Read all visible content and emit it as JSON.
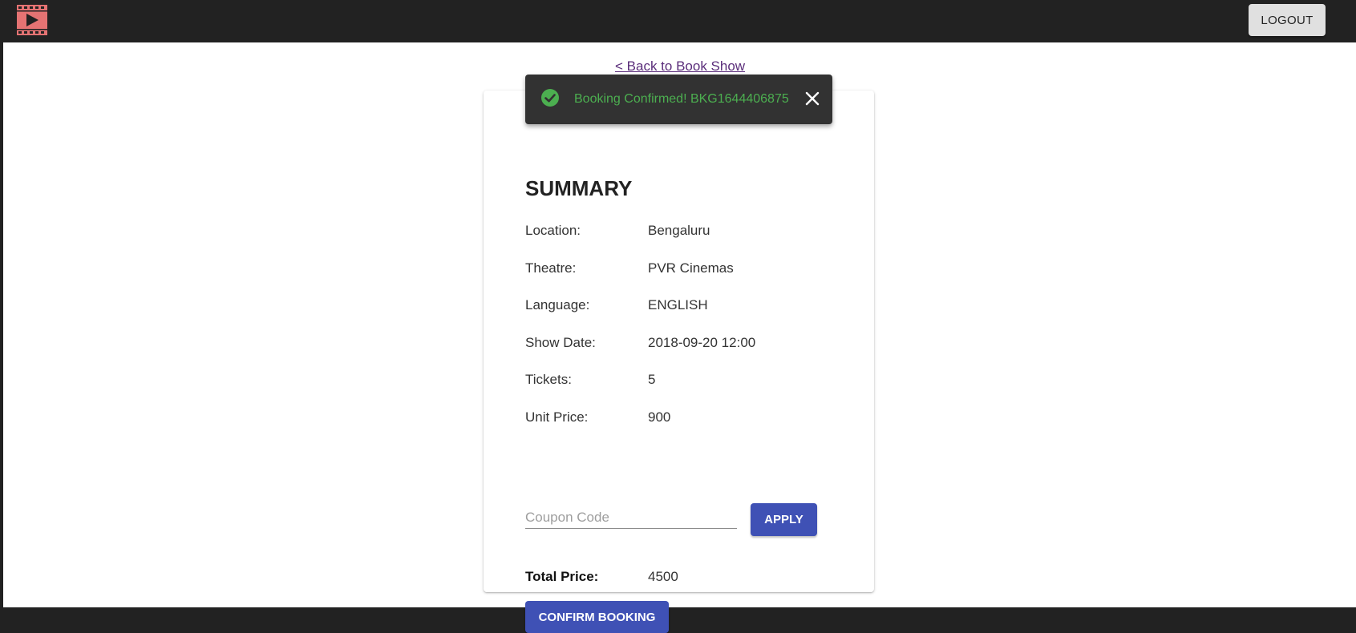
{
  "header": {
    "logo_icon": "film-play-icon",
    "logout_label": "LOGOUT"
  },
  "nav": {
    "back_link": "< Back to Book Show"
  },
  "snackbar": {
    "icon": "check-circle-icon",
    "message": "Booking Confirmed! BKG1644406875",
    "close_icon": "close-icon",
    "text_color": "#4caf50"
  },
  "summary": {
    "title": "SUMMARY",
    "rows": [
      {
        "label": "Location:",
        "value": "Bengaluru"
      },
      {
        "label": "Theatre:",
        "value": "PVR Cinemas"
      },
      {
        "label": "Language:",
        "value": "ENGLISH"
      },
      {
        "label": "Show Date:",
        "value": "2018-09-20 12:00"
      },
      {
        "label": "Tickets:",
        "value": "5"
      },
      {
        "label": "Unit Price:",
        "value": "900"
      }
    ],
    "coupon": {
      "value": "",
      "placeholder": "Coupon Code",
      "apply_label": "APPLY"
    },
    "total_label": "Total Price:",
    "total_value": "4500",
    "confirm_label": "CONFIRM BOOKING"
  },
  "colors": {
    "header_bg": "#222222",
    "primary": "#3f51b5",
    "logo": "#e57373"
  }
}
